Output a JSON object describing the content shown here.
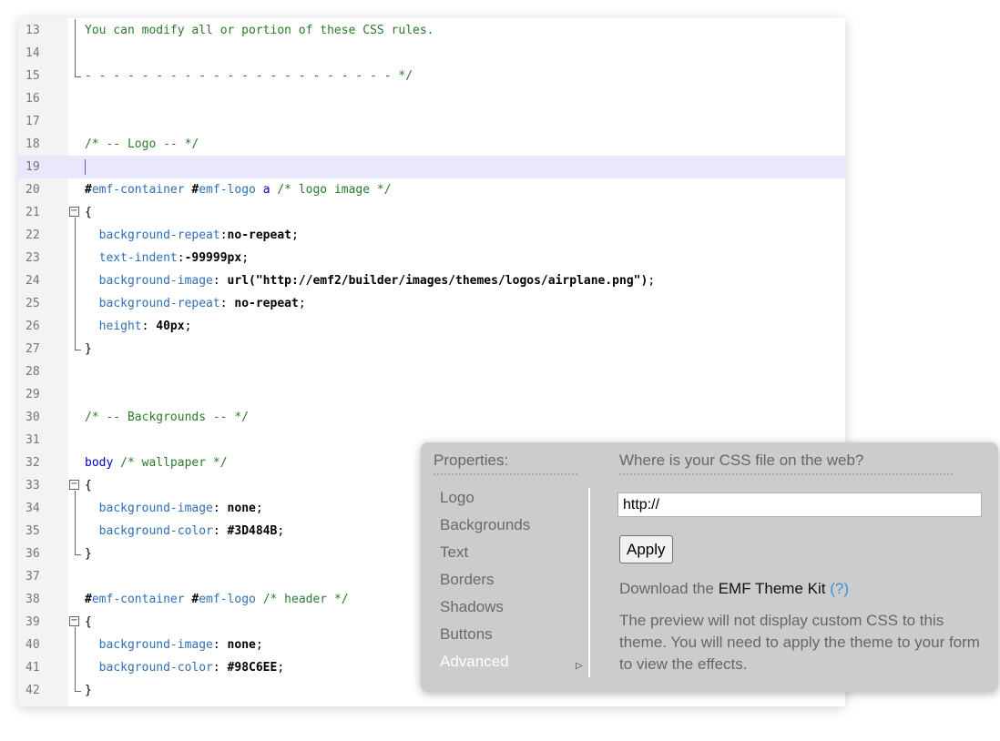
{
  "editor": {
    "lines": [
      {
        "n": "13",
        "fold": "bar",
        "parts": [
          [
            "c-comment",
            "You can modify all or portion of these CSS rules."
          ]
        ]
      },
      {
        "n": "14",
        "fold": "bar",
        "parts": []
      },
      {
        "n": "15",
        "fold": "end",
        "parts": [
          [
            "c-comment",
            "- - - - - - - - - - - - - - - - - - - - - - */"
          ]
        ]
      },
      {
        "n": "16",
        "parts": []
      },
      {
        "n": "17",
        "parts": []
      },
      {
        "n": "18",
        "parts": [
          [
            "c-comment",
            "/* -- Logo -- */"
          ]
        ]
      },
      {
        "n": "19",
        "highlight": true,
        "cursor": true,
        "parts": []
      },
      {
        "n": "20",
        "parts": [
          [
            "c-hash",
            "#"
          ],
          [
            "c-id",
            "emf-container"
          ],
          [
            "c-plain",
            " "
          ],
          [
            "c-hash",
            "#"
          ],
          [
            "c-id",
            "emf-logo"
          ],
          [
            "c-plain",
            " "
          ],
          [
            "c-sel",
            "a"
          ],
          [
            "c-plain",
            " "
          ],
          [
            "c-comment",
            "/* logo image */"
          ]
        ]
      },
      {
        "n": "21",
        "fold": "box",
        "parts": [
          [
            "c-plain",
            "{"
          ]
        ]
      },
      {
        "n": "22",
        "fold": "bar",
        "parts": [
          [
            "c-plain",
            "  "
          ],
          [
            "c-prop",
            "background-repeat"
          ],
          [
            "c-plain",
            ":"
          ],
          [
            "c-val",
            "no-repeat"
          ],
          [
            "c-plain",
            ";"
          ]
        ]
      },
      {
        "n": "23",
        "fold": "bar",
        "parts": [
          [
            "c-plain",
            "  "
          ],
          [
            "c-prop",
            "text-indent"
          ],
          [
            "c-plain",
            ":"
          ],
          [
            "c-val",
            "-99999px"
          ],
          [
            "c-plain",
            ";"
          ]
        ]
      },
      {
        "n": "24",
        "fold": "bar",
        "parts": [
          [
            "c-plain",
            "  "
          ],
          [
            "c-prop",
            "background-image"
          ],
          [
            "c-plain",
            ": "
          ],
          [
            "c-val",
            "url(\"http://emf2/builder/images/themes/logos/airplane.png\")"
          ],
          [
            "c-plain",
            ";"
          ]
        ]
      },
      {
        "n": "25",
        "fold": "bar",
        "parts": [
          [
            "c-plain",
            "  "
          ],
          [
            "c-prop",
            "background-repeat"
          ],
          [
            "c-plain",
            ": "
          ],
          [
            "c-val",
            "no-repeat"
          ],
          [
            "c-plain",
            ";"
          ]
        ]
      },
      {
        "n": "26",
        "fold": "bar",
        "parts": [
          [
            "c-plain",
            "  "
          ],
          [
            "c-prop",
            "height"
          ],
          [
            "c-plain",
            ": "
          ],
          [
            "c-val",
            "40px"
          ],
          [
            "c-plain",
            ";"
          ]
        ]
      },
      {
        "n": "27",
        "fold": "end",
        "parts": [
          [
            "c-plain",
            "}"
          ]
        ]
      },
      {
        "n": "28",
        "parts": []
      },
      {
        "n": "29",
        "parts": []
      },
      {
        "n": "30",
        "parts": [
          [
            "c-comment",
            "/* -- Backgrounds -- */"
          ]
        ]
      },
      {
        "n": "31",
        "parts": []
      },
      {
        "n": "32",
        "parts": [
          [
            "c-sel",
            "body"
          ],
          [
            "c-plain",
            " "
          ],
          [
            "c-comment",
            "/* wallpaper */"
          ]
        ]
      },
      {
        "n": "33",
        "fold": "box",
        "parts": [
          [
            "c-plain",
            "{"
          ]
        ]
      },
      {
        "n": "34",
        "fold": "bar",
        "parts": [
          [
            "c-plain",
            "  "
          ],
          [
            "c-prop",
            "background-image"
          ],
          [
            "c-plain",
            ": "
          ],
          [
            "c-val",
            "none"
          ],
          [
            "c-plain",
            ";"
          ]
        ]
      },
      {
        "n": "35",
        "fold": "bar",
        "parts": [
          [
            "c-plain",
            "  "
          ],
          [
            "c-prop",
            "background-color"
          ],
          [
            "c-plain",
            ": "
          ],
          [
            "c-val",
            "#3D484B"
          ],
          [
            "c-plain",
            ";"
          ]
        ]
      },
      {
        "n": "36",
        "fold": "end",
        "parts": [
          [
            "c-plain",
            "}"
          ]
        ]
      },
      {
        "n": "37",
        "parts": []
      },
      {
        "n": "38",
        "parts": [
          [
            "c-hash",
            "#"
          ],
          [
            "c-id",
            "emf-container"
          ],
          [
            "c-plain",
            " "
          ],
          [
            "c-hash",
            "#"
          ],
          [
            "c-id",
            "emf-logo"
          ],
          [
            "c-plain",
            " "
          ],
          [
            "c-comment",
            "/* header */"
          ]
        ]
      },
      {
        "n": "39",
        "fold": "box",
        "parts": [
          [
            "c-plain",
            "{"
          ]
        ]
      },
      {
        "n": "40",
        "fold": "bar",
        "parts": [
          [
            "c-plain",
            "  "
          ],
          [
            "c-prop",
            "background-image"
          ],
          [
            "c-plain",
            ": "
          ],
          [
            "c-val",
            "none"
          ],
          [
            "c-plain",
            ";"
          ]
        ]
      },
      {
        "n": "41",
        "fold": "bar",
        "parts": [
          [
            "c-plain",
            "  "
          ],
          [
            "c-prop",
            "background-color"
          ],
          [
            "c-plain",
            ": "
          ],
          [
            "c-val",
            "#98C6EE"
          ],
          [
            "c-plain",
            ";"
          ]
        ]
      },
      {
        "n": "42",
        "fold": "end",
        "parts": [
          [
            "c-plain",
            "}"
          ]
        ]
      }
    ]
  },
  "panel": {
    "properties_title": "Properties:",
    "properties": [
      "Logo",
      "Backgrounds",
      "Text",
      "Borders",
      "Shadows",
      "Buttons",
      "Advanced"
    ],
    "active_property": "Advanced",
    "css_title": "Where is your CSS file on the web?",
    "url_value": "http://",
    "apply_label": "Apply",
    "download_prefix": "Download the ",
    "kit_link": "EMF Theme Kit",
    "help_link": "(?)",
    "preview_note": "The preview will not display custom CSS to this theme. You will need to apply the theme to your form to view the effects."
  },
  "colors": {
    "comment": "#2a7a2a",
    "property": "#2e6fb5",
    "line_highlight": "#e8e8fa",
    "panel_bg": "#cccccc",
    "help_link": "#3a8fd4"
  },
  "icons": {
    "fold_box": "minus-box-icon",
    "advanced_arrow": "triangle-right-icon"
  }
}
